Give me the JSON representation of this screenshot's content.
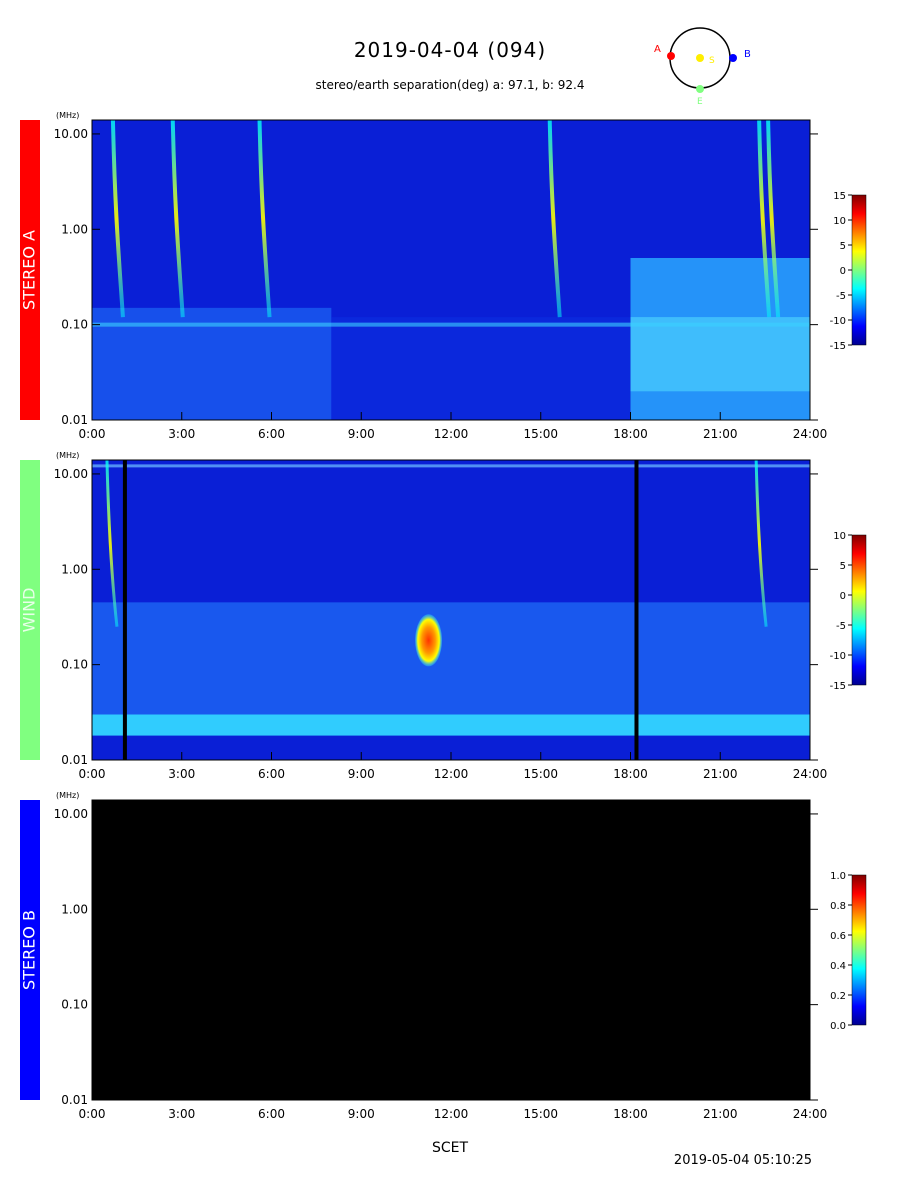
{
  "header": {
    "title": "2019-04-04 (094)",
    "subtitle": "stereo/earth separation(deg) a:  97.1, b:  92.4",
    "orbit_labels": {
      "a": "A",
      "b": "B",
      "sun": "S",
      "earth": "E"
    }
  },
  "footer": {
    "xlabel": "SCET",
    "timestamp": "2019-05-04 05:10:25"
  },
  "chart_data": [
    {
      "type": "heatmap",
      "panel_label": "STEREO A",
      "panel_color": "#ff0000",
      "yunit": "(MHz)",
      "yscale": "log",
      "ylim": [
        0.01,
        14
      ],
      "yticks": [
        "10.00",
        "1.00",
        "0.10",
        "0.01"
      ],
      "xlim": [
        0,
        24
      ],
      "xticks": [
        "0:00",
        "3:00",
        "6:00",
        "9:00",
        "12:00",
        "15:00",
        "18:00",
        "21:00",
        "24:00"
      ],
      "colorbar": {
        "range": [
          -15,
          15
        ],
        "ticks": [
          "15",
          "10",
          "5",
          "0",
          "-5",
          "-10",
          "-15"
        ]
      },
      "bursts_hours": [
        0.7,
        2.7,
        5.6,
        15.3,
        22.3,
        22.6
      ],
      "elevated_background_interval_hours": [
        18.0,
        24.0
      ]
    },
    {
      "type": "heatmap",
      "panel_label": "WIND",
      "panel_color": "#80ff80",
      "yunit": "(MHz)",
      "yscale": "log",
      "ylim": [
        0.01,
        14
      ],
      "yticks": [
        "10.00",
        "1.00",
        "0.10",
        "0.01"
      ],
      "xlim": [
        0,
        24
      ],
      "xticks": [
        "0:00",
        "3:00",
        "6:00",
        "9:00",
        "12:00",
        "15:00",
        "18:00",
        "21:00",
        "24:00"
      ],
      "colorbar": {
        "range": [
          -15,
          10
        ],
        "ticks": [
          "10",
          "5",
          "0",
          "-5",
          "-10",
          "-15"
        ]
      },
      "bursts_hours": [
        0.5,
        22.2
      ],
      "strong_emission_hours": [
        11.0,
        11.5
      ],
      "data_gap_hours": [
        1.1,
        18.2
      ]
    },
    {
      "type": "heatmap",
      "panel_label": "STEREO B",
      "panel_color": "#0000ff",
      "yunit": "(MHz)",
      "yscale": "log",
      "ylim": [
        0.01,
        14
      ],
      "yticks": [
        "10.00",
        "1.00",
        "0.10",
        "0.01"
      ],
      "xlim": [
        0,
        24
      ],
      "xticks": [
        "0:00",
        "3:00",
        "6:00",
        "9:00",
        "12:00",
        "15:00",
        "18:00",
        "21:00",
        "24:00"
      ],
      "colorbar": {
        "range": [
          0.0,
          1.0
        ],
        "ticks": [
          "1.0",
          "0.8",
          "0.6",
          "0.4",
          "0.2",
          "0.0"
        ]
      },
      "no_data": true
    }
  ]
}
